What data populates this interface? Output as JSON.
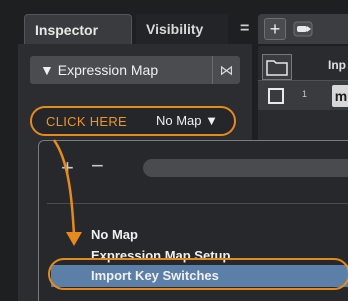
{
  "tabs": {
    "inspector": "Inspector",
    "visibility": "Visibility",
    "menu": "="
  },
  "inspector": {
    "section_title": "▼ Expression Map",
    "section_icon": "⋈",
    "click_here": "CLICK HERE",
    "map_select": "No Map ▼"
  },
  "project": {
    "add": "+",
    "header_text": "Inp",
    "track_number": "1",
    "track_m": "m"
  },
  "popup": {
    "add": "+",
    "remove": "−",
    "menu_items": [
      "No Map",
      "Expression Map Setup...",
      "Import Key Switches"
    ]
  },
  "colors": {
    "annotation_orange": "#e68a1c",
    "selection_blue": "#5c7fa8"
  }
}
